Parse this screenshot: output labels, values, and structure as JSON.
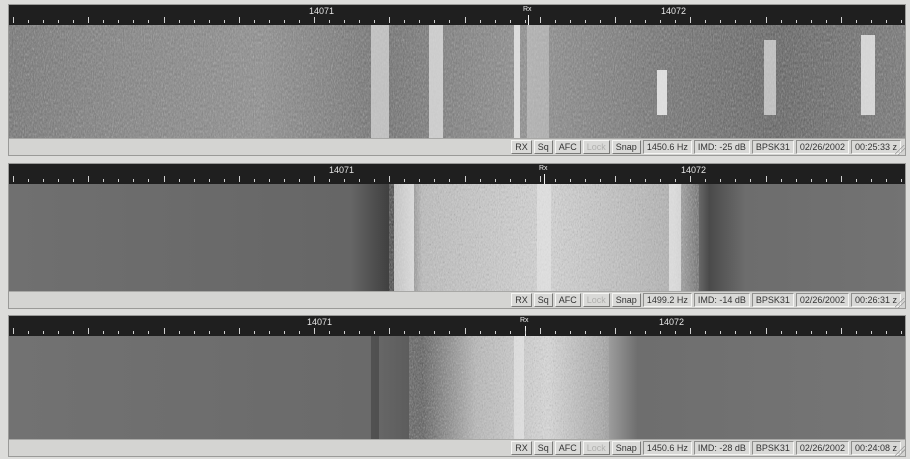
{
  "panels": [
    {
      "ruler": {
        "freq_left": "14071",
        "freq_right": "14072",
        "marker": "Rx"
      },
      "status": {
        "rx": "RX",
        "sq": "Sq",
        "afc": "AFC",
        "lock": "Lock",
        "snap": "Snap",
        "freq": "1450.6 Hz",
        "imd": "IMD: -25 dB",
        "mode": "BPSK31",
        "date": "02/26/2002",
        "time": "00:25:33 z"
      }
    },
    {
      "ruler": {
        "freq_left": "14071",
        "freq_right": "14072",
        "marker": "Rx"
      },
      "status": {
        "rx": "RX",
        "sq": "Sq",
        "afc": "AFC",
        "lock": "Lock",
        "snap": "Snap",
        "freq": "1499.2 Hz",
        "imd": "IMD: -14 dB",
        "mode": "BPSK31",
        "date": "02/26/2002",
        "time": "00:26:31 z"
      }
    },
    {
      "ruler": {
        "freq_left": "14071",
        "freq_right": "14072",
        "marker": "Rx"
      },
      "status": {
        "rx": "RX",
        "sq": "Sq",
        "afc": "AFC",
        "lock": "Lock",
        "snap": "Snap",
        "freq": "1450.6 Hz",
        "imd": "IMD: -28 dB",
        "mode": "BPSK31",
        "date": "02/26/2002",
        "time": "00:24:08 z"
      }
    }
  ],
  "icons": {
    "rx_marker": "rx-cursor-icon",
    "grip": "resize-grip-icon"
  }
}
